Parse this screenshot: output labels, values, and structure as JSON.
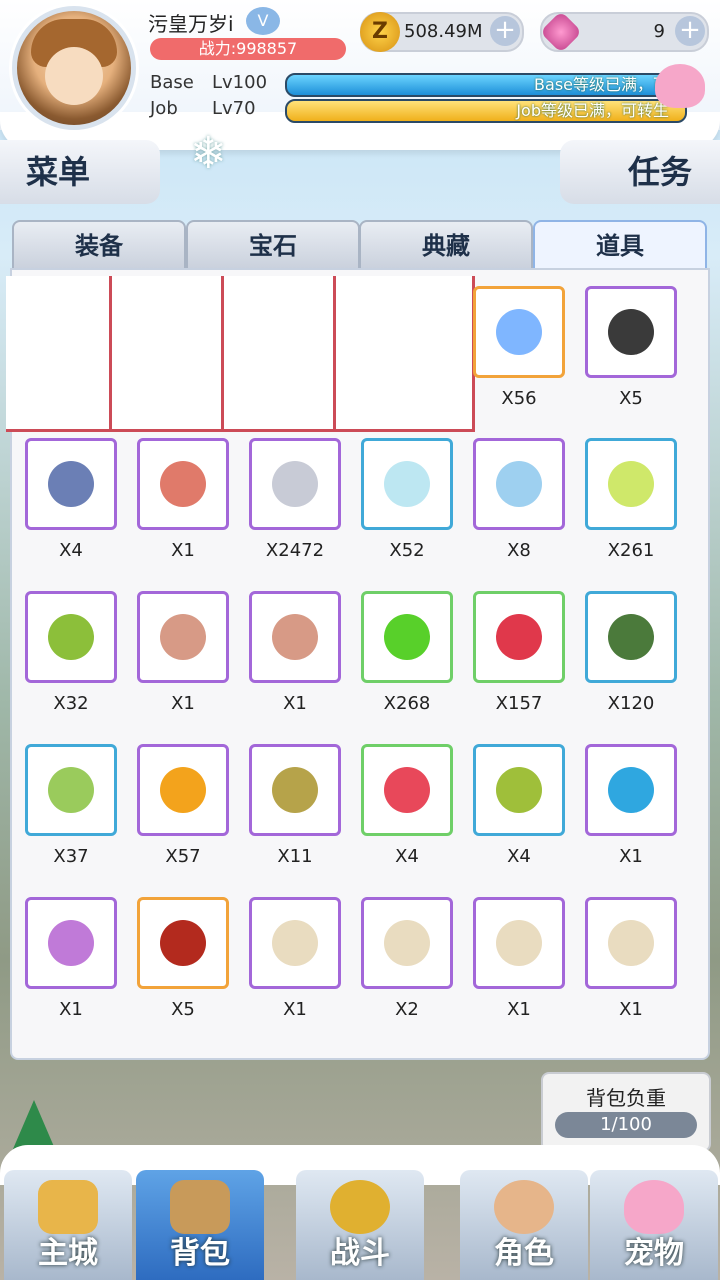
{
  "player": {
    "name": "污皇万岁i",
    "power": "战力:998857"
  },
  "levels": {
    "base_label": "Base",
    "base_lv": "Lv100",
    "base_bar_text": "Base等级已满，可",
    "job_label": "Job",
    "job_lv": "Lv70",
    "job_bar_text": "Job等级已满，可转生"
  },
  "resources": {
    "zeny": "508.49M",
    "gem": "9"
  },
  "buttons": {
    "menu": "菜单",
    "task": "任务",
    "plus": "+"
  },
  "tabs": [
    {
      "label": "装备",
      "active": false
    },
    {
      "label": "宝石",
      "active": false
    },
    {
      "label": "典藏",
      "active": false
    },
    {
      "label": "道具",
      "active": true
    }
  ],
  "items": [
    {
      "count": "X56",
      "rarity": "orange",
      "icon": "crystal-icon",
      "color": "#7fb6ff"
    },
    {
      "count": "X5",
      "rarity": "purple",
      "icon": "bat-card-icon",
      "color": "#3a3a3a"
    },
    {
      "count": "X4",
      "rarity": "purple",
      "icon": "staff-icon",
      "color": "#6b7fb5"
    },
    {
      "count": "X1",
      "rarity": "purple",
      "icon": "ticket-icon",
      "color": "#e07a6a"
    },
    {
      "count": "X2472",
      "rarity": "purple",
      "icon": "stone-icon",
      "color": "#c8cbd6"
    },
    {
      "count": "X52",
      "rarity": "blue",
      "icon": "vial-icon",
      "color": "#bde7f2"
    },
    {
      "count": "X8",
      "rarity": "purple",
      "icon": "jar-icon",
      "color": "#9ed0f0"
    },
    {
      "count": "X261",
      "rarity": "blue",
      "icon": "potion-icon",
      "color": "#cfe86a"
    },
    {
      "count": "X32",
      "rarity": "purple",
      "icon": "green-jar-icon",
      "color": "#8cbf3a"
    },
    {
      "count": "X1",
      "rarity": "purple",
      "icon": "scroll-card-icon",
      "color": "#d79a86"
    },
    {
      "count": "X1",
      "rarity": "purple",
      "icon": "scroll-card-icon",
      "color": "#d79a86"
    },
    {
      "count": "X268",
      "rarity": "green",
      "icon": "apple-icon",
      "color": "#58d02a"
    },
    {
      "count": "X157",
      "rarity": "green",
      "icon": "strawberry-icon",
      "color": "#e0384b"
    },
    {
      "count": "X120",
      "rarity": "blue",
      "icon": "melon-icon",
      "color": "#4b7a3b"
    },
    {
      "count": "X37",
      "rarity": "blue",
      "icon": "cantaloupe-icon",
      "color": "#9acb5c"
    },
    {
      "count": "X57",
      "rarity": "purple",
      "icon": "mango-icon",
      "color": "#f3a31c"
    },
    {
      "count": "X11",
      "rarity": "purple",
      "icon": "durian-icon",
      "color": "#b6a34a"
    },
    {
      "count": "X4",
      "rarity": "green",
      "icon": "red-candy-icon",
      "color": "#e8485a"
    },
    {
      "count": "X4",
      "rarity": "blue",
      "icon": "green-candy-icon",
      "color": "#9fbf3a"
    },
    {
      "count": "X1",
      "rarity": "purple",
      "icon": "blue-candy-icon",
      "color": "#2fa7e0"
    },
    {
      "count": "X1",
      "rarity": "purple",
      "icon": "purple-candy-icon",
      "color": "#c07ad8"
    },
    {
      "count": "X5",
      "rarity": "orange",
      "icon": "black-candy-icon",
      "color": "#b32a1e"
    },
    {
      "count": "X1",
      "rarity": "purple",
      "icon": "paper-icon",
      "color": "#e9dcc0"
    },
    {
      "count": "X2",
      "rarity": "purple",
      "icon": "paper-icon",
      "color": "#e9dcc0"
    },
    {
      "count": "X1",
      "rarity": "purple",
      "icon": "paper-icon",
      "color": "#e9dcc0"
    },
    {
      "count": "X1",
      "rarity": "purple",
      "icon": "paper-icon",
      "color": "#e9dcc0"
    }
  ],
  "bag_weight": {
    "label": "背包负重",
    "value": "1/100"
  },
  "nav": [
    {
      "label": "主城",
      "active": false,
      "icon": "castle-icon"
    },
    {
      "label": "背包",
      "active": true,
      "icon": "backpack-icon"
    },
    {
      "label": "战斗",
      "active": false,
      "icon": "battle-icon"
    },
    {
      "label": "角色",
      "active": false,
      "icon": "character-icon"
    },
    {
      "label": "宠物",
      "active": false,
      "icon": "pet-icon"
    }
  ]
}
